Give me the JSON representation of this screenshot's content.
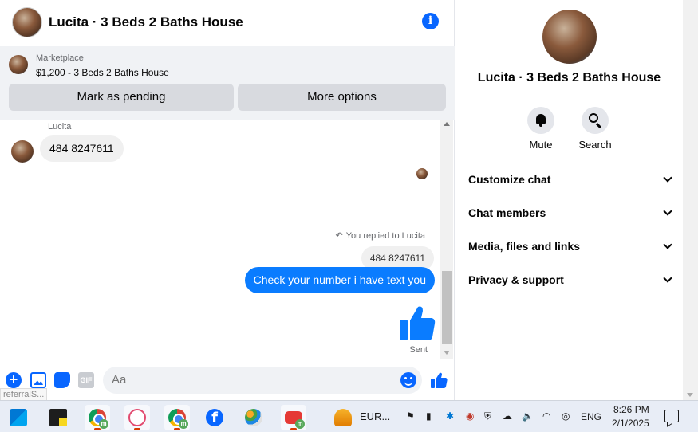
{
  "header": {
    "title": "Lucita · 3 Beds 2 Baths House",
    "info_icon": "info-icon"
  },
  "listing": {
    "source": "Marketplace",
    "title": "$1,200 - 3 Beds 2 Baths House",
    "mark_pending_label": "Mark as pending",
    "more_options_label": "More options"
  },
  "messages": {
    "sender_name": "Lucita",
    "incoming_text": "484 8247611",
    "reply_note": "You replied to Lucita",
    "quoted_text": "484 8247611",
    "outgoing_text": "Check your number i have text you",
    "sent_label": "Sent"
  },
  "composer": {
    "placeholder": "Aa",
    "gif_label": "GIF",
    "tooltip_fragment": "referralS..."
  },
  "info_panel": {
    "title": "Lucita · 3 Beds 2 Baths House",
    "actions": [
      {
        "label": "Mute",
        "icon": "bell-icon"
      },
      {
        "label": "Search",
        "icon": "search-icon"
      }
    ],
    "sections": [
      {
        "label": "Customize chat"
      },
      {
        "label": "Chat members"
      },
      {
        "label": "Media, files and links"
      },
      {
        "label": "Privacy & support"
      }
    ]
  },
  "taskbar": {
    "pinned_apps": [
      "store-icon",
      "sticky-notes-icon",
      "chrome-icon",
      "snip-icon",
      "chrome-profile-icon",
      "facebook-icon",
      "paint-icon",
      "youtube-icon",
      "coin-icon"
    ],
    "eur_label": "EUR...",
    "language": "ENG",
    "time": "8:26 PM",
    "date": "2/1/2025"
  },
  "colors": {
    "accent": "#0866ff",
    "outgoing_bubble": "#0a7cff",
    "incoming_bubble": "#f0f0f0",
    "button_bg": "#d8dadf"
  }
}
